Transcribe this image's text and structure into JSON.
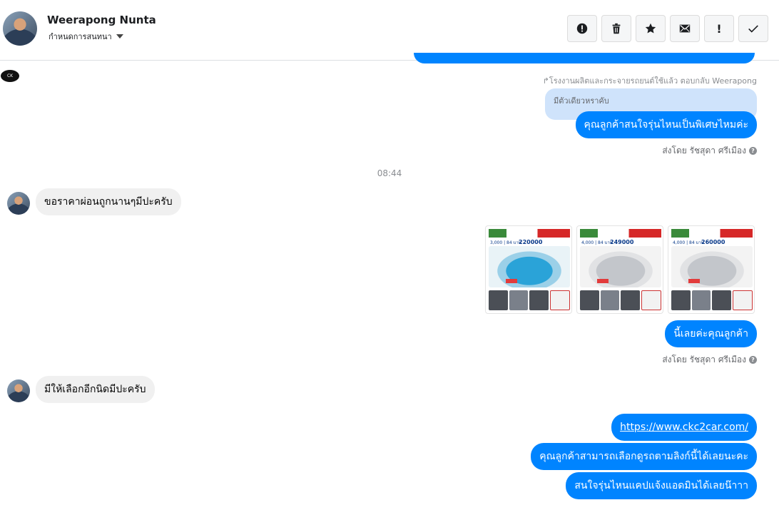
{
  "header": {
    "name": "Weerapong Nunta",
    "subtitle": "กำหนดการสนทนา",
    "actions": [
      {
        "name": "report",
        "icon": "exclamation-circle-icon"
      },
      {
        "name": "delete",
        "icon": "trash-icon"
      },
      {
        "name": "star",
        "icon": "star-icon"
      },
      {
        "name": "mark-unread",
        "icon": "envelope-icon"
      },
      {
        "name": "important",
        "icon": "exclamation-icon",
        "label": "!"
      },
      {
        "name": "done",
        "icon": "checkmark-icon"
      }
    ]
  },
  "thread": {
    "page_logo_text": "CK",
    "reply_meta": "↱โรงงานผลิตและกระจายรถยนต์ใช้แล้ว ตอบกลับ Weerapong",
    "quoted_text": "มีตัวเดียวหราคับ",
    "reply_message": "คุณลูกค้าสนใจรุ่นไหนเป็นพิเศษไหมค่ะ",
    "sent_by_1": "ส่งโดย รัชสุดา ศรีเมือง",
    "timestamp": "08:44",
    "in_message_1": "ขอราคาผ่อนถูกนานๆมีปะครับ",
    "car_cards": [
      {
        "mileage": "3,000 | 84 บาท",
        "price": "220000",
        "color": "blue"
      },
      {
        "mileage": "4,000 | 84 บาท",
        "price": "249000",
        "color": "silver"
      },
      {
        "mileage": "4,000 | 84 บาท",
        "price": "260000",
        "color": "silver"
      }
    ],
    "out_message_2": "นี้เลยค่ะคุณลูกค้า",
    "sent_by_2": "ส่งโดย รัชสุดา ศรีเมือง",
    "in_message_2": "มีให้เลือกอีกนิดมีปะครับ",
    "link_message": "https://www.ckc2car.com/",
    "out_message_3": "คุณลูกค้าสามารถเลือกดูรถตามลิงก์นี้ได้เลยนะคะ",
    "out_message_4": "สนใจรุ่นไหนแคปแจ้งแอดมินได้เลยน๊าาา",
    "help_glyph": "?"
  }
}
